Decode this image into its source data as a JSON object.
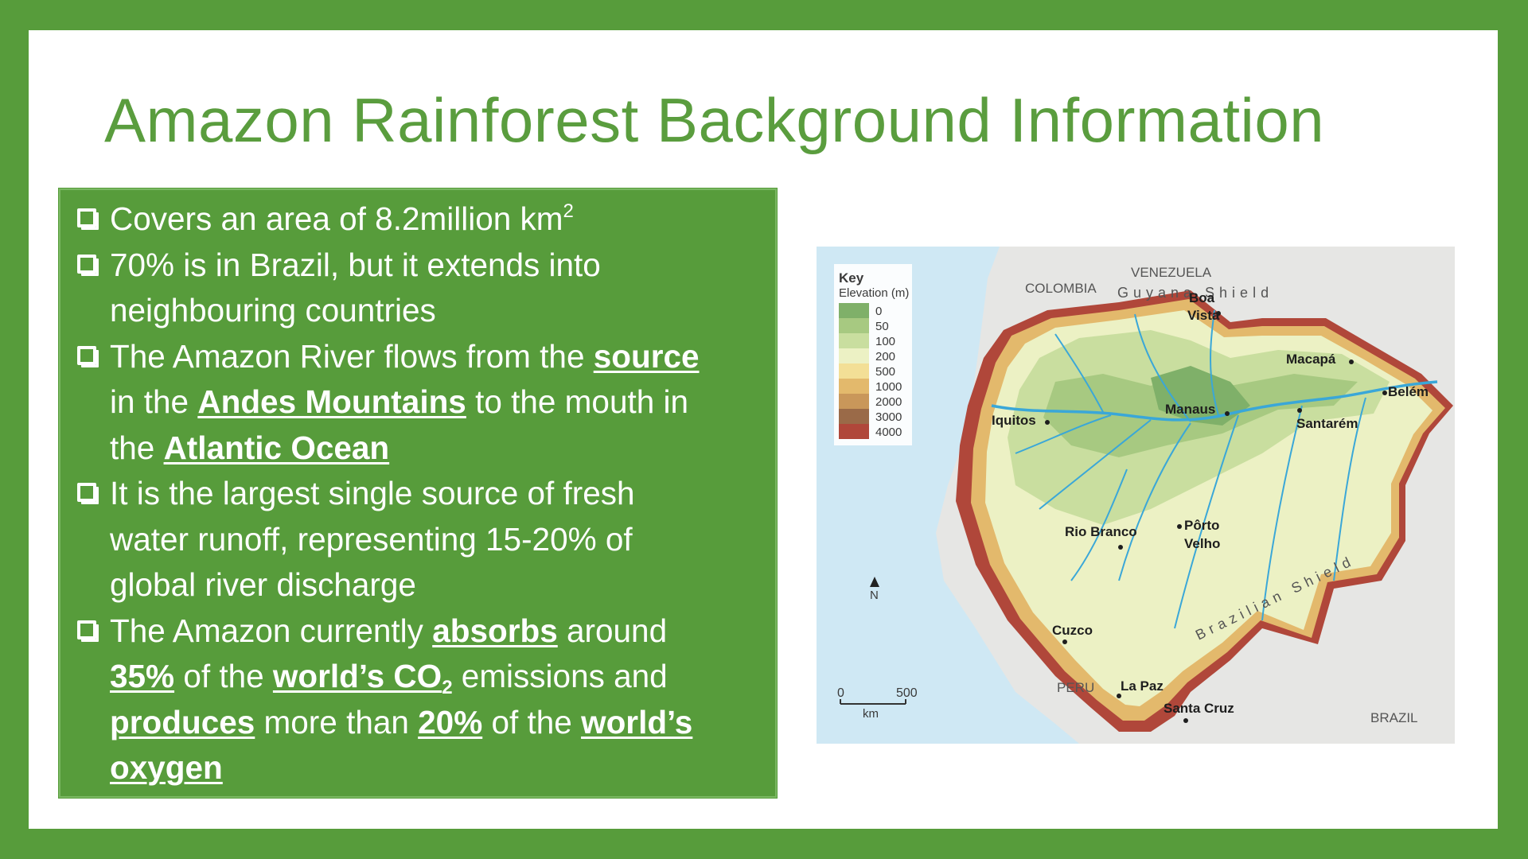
{
  "slide": {
    "title": "Amazon Rainforest Background Information",
    "bullets": {
      "b1": {
        "text": "Covers an area of 8.2million km",
        "sup": "2"
      },
      "b2": {
        "line1": "70% is in Brazil, but it extends into",
        "line2": "neighbouring countries"
      },
      "b3": {
        "t1": "The Amazon River flows from the ",
        "u1": "source",
        "t2": "in the ",
        "u2": "Andes Mountains",
        "t3": " to the mouth in",
        "t4": "the ",
        "u3": "Atlantic Ocean"
      },
      "b4": {
        "line1": "It is the largest single source of fresh",
        "line2": "water runoff, representing 15-20% of",
        "line3": "global river discharge"
      },
      "b5": {
        "t1": "The Amazon currently ",
        "u1": "absorbs",
        "t2": " around",
        "u2": "35%",
        "t3": " of the ",
        "u3": "world’s CO",
        "u3sub": "2",
        "t4": " emissions and",
        "u4": "produces",
        "t5": " more than ",
        "u5": "20%",
        "t6": " of the ",
        "u6": "world’s",
        "u7": "oxygen"
      }
    }
  },
  "map": {
    "key_title": "Key",
    "key_subtitle": "Elevation (m)",
    "key_levels": [
      "0",
      "50",
      "100",
      "200",
      "500",
      "1000",
      "2000",
      "3000",
      "4000"
    ],
    "key_colors": [
      "#7fb069",
      "#a7c981",
      "#c9de9f",
      "#ecf1c4",
      "#f3df96",
      "#e3b96c",
      "#c9975a",
      "#9a6a48",
      "#b0473a"
    ],
    "countries": {
      "colombia": "COLOMBIA",
      "venezuela": "VENEZUELA",
      "peru": "PERU",
      "brazil": "BRAZIL"
    },
    "regions": {
      "guyana": "Guyana Shield",
      "brazilian": "Brazilian Shield"
    },
    "cities": {
      "boa_vista_1": "Boa",
      "boa_vista_2": "Vista",
      "macapa": "Macapá",
      "belem": "Belém",
      "manaus": "Manaus",
      "santarem": "Santarém",
      "iquitos": "Iquitos",
      "rio_branco": "Rio Branco",
      "porto_velho_1": "Pôrto",
      "porto_velho_2": "Velho",
      "cuzco": "Cuzco",
      "la_paz": "La Paz",
      "santa_cruz": "Santa Cruz"
    },
    "north": "N",
    "scale": {
      "zero": "0",
      "max": "500",
      "unit": "km"
    },
    "colors": {
      "ocean": "#cfe8f4",
      "land_outside": "#e6e6e4",
      "river": "#3aa7d8"
    }
  }
}
